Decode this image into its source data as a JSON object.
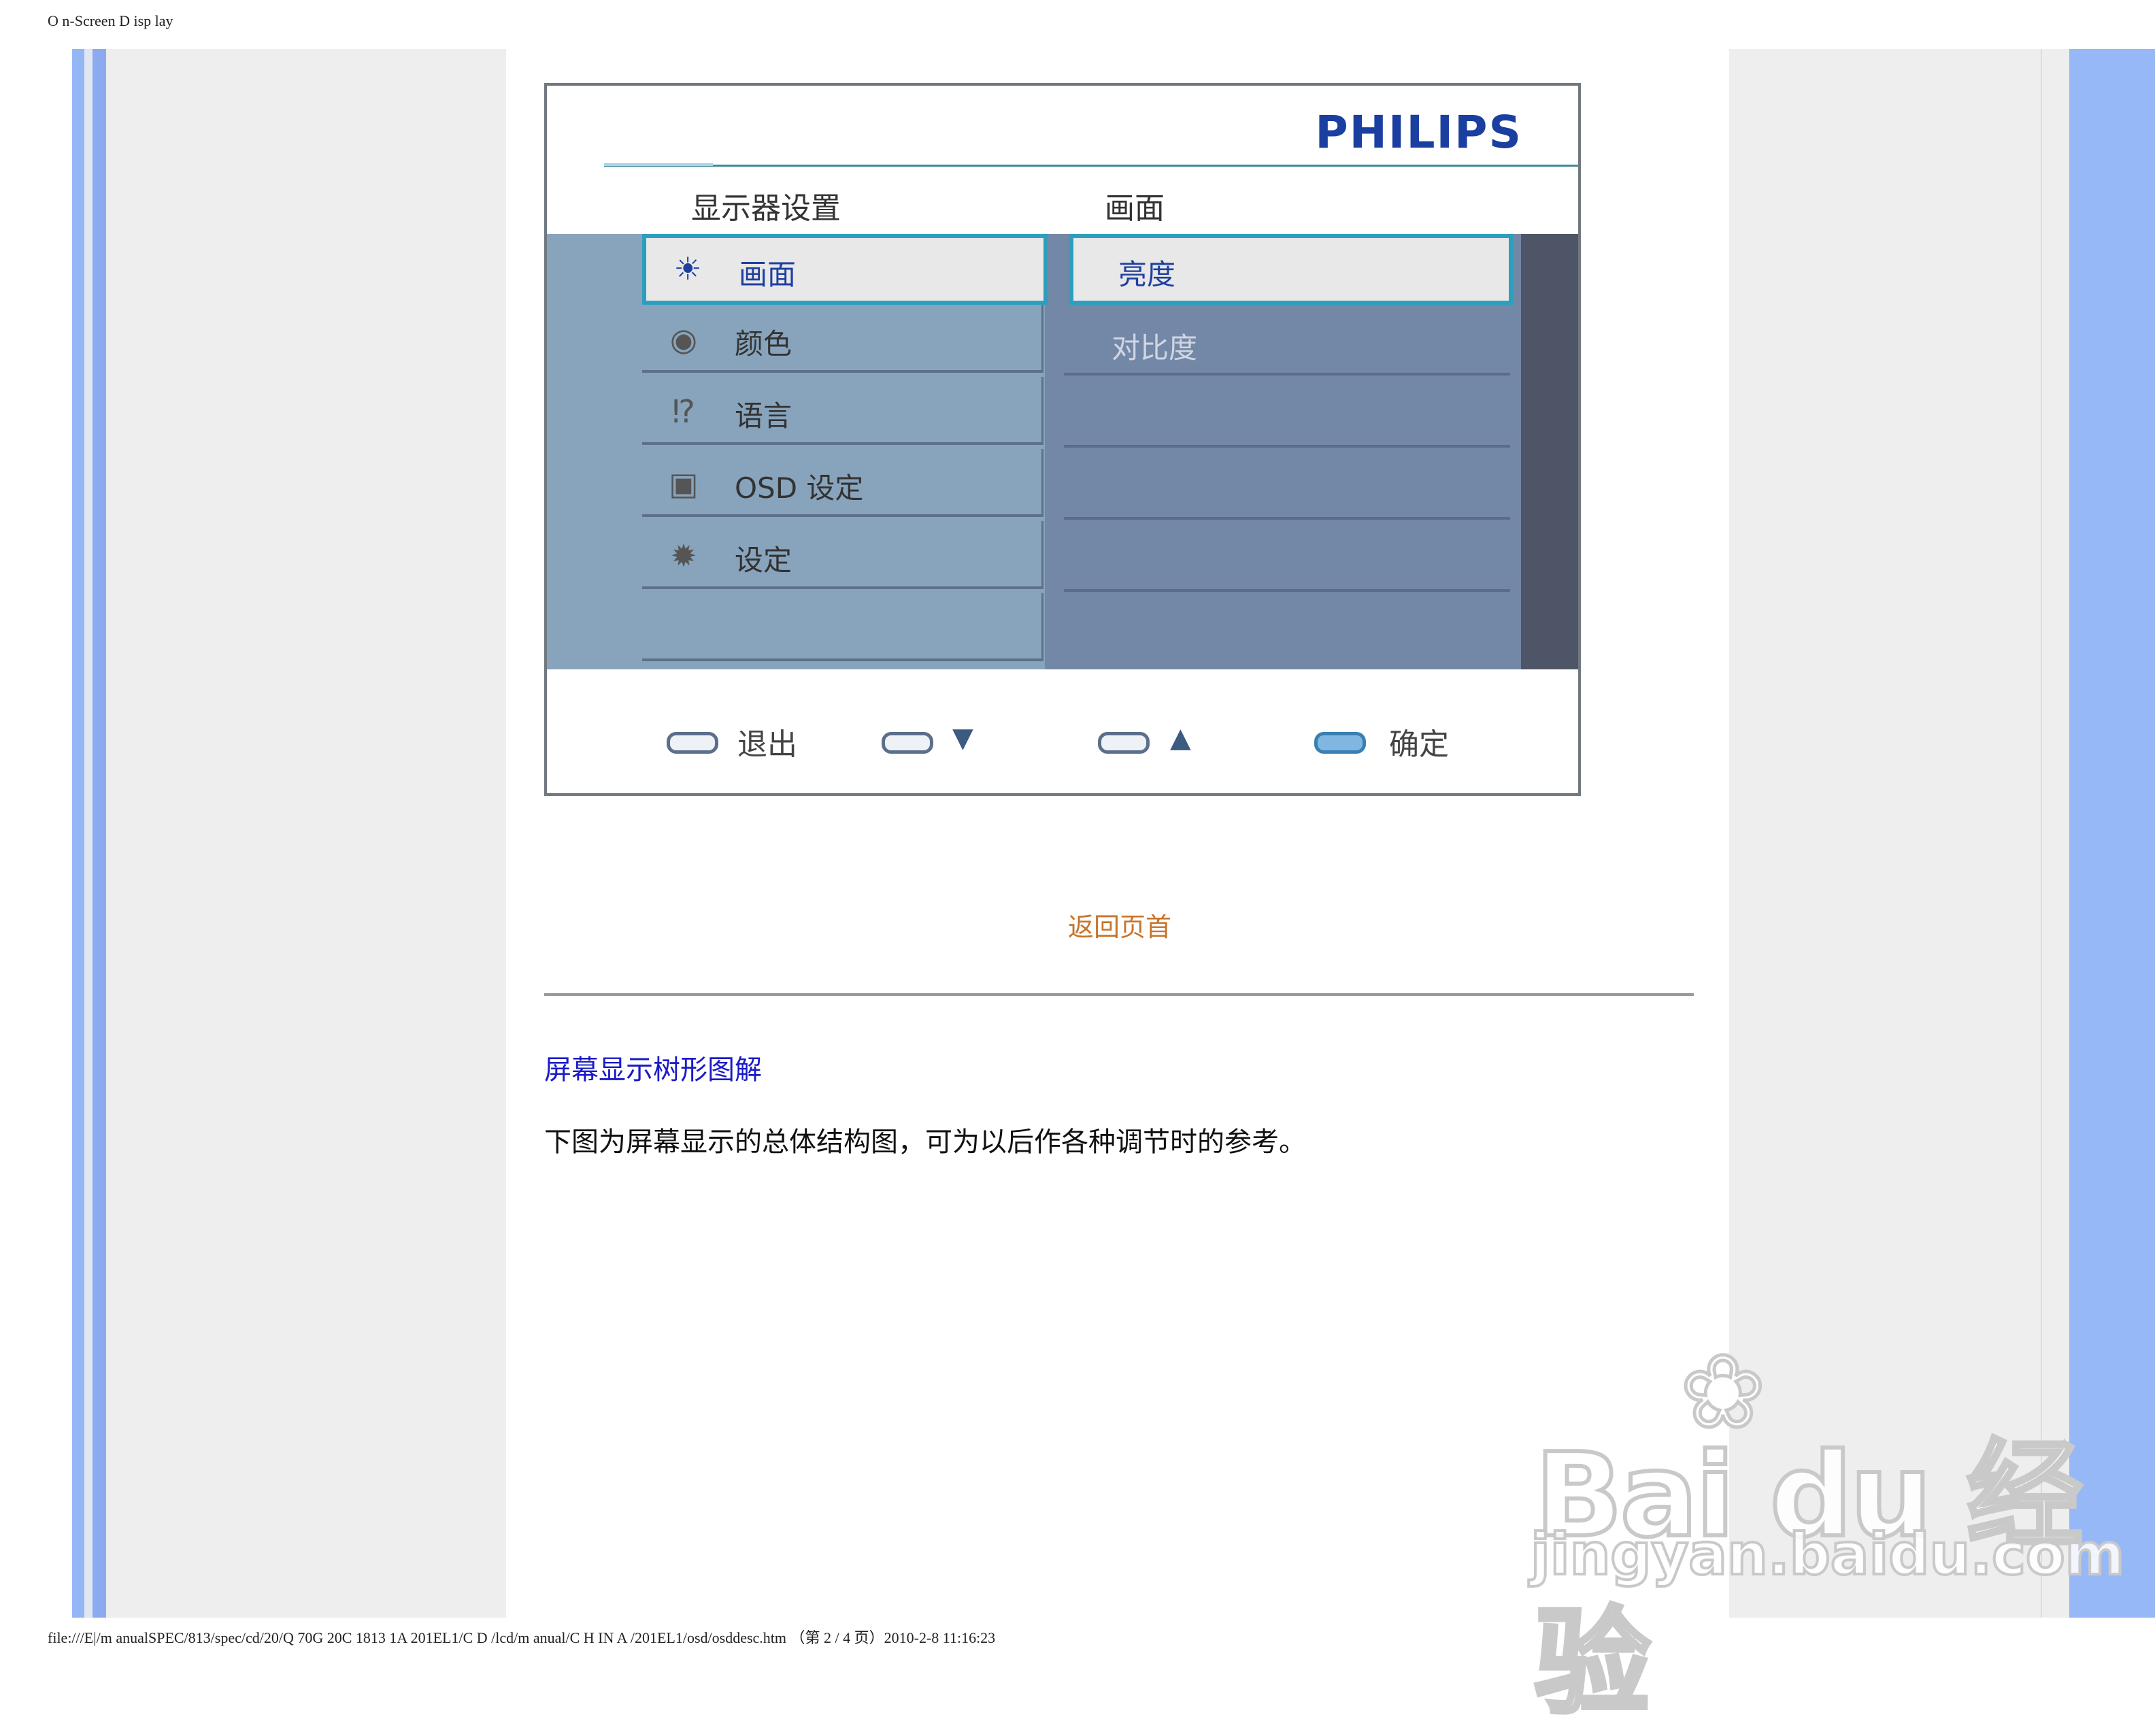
{
  "page_header": "O n-Screen D isp lay",
  "page_footer": "file:///E|/m anualSPEC/813/spec/cd/20/Q 70G 20C 1813 1A 201EL1/C D /lcd/m anual/C H IN A /201EL1/osd/osddesc.htm （第 2 / 4 页）2010-2-8 11:16:23",
  "osd": {
    "brand": "PHILIPS",
    "header_left": "显示器设置",
    "header_right": "画面",
    "menu_items": [
      {
        "icon": "brightness-icon",
        "glyph": "☀",
        "label": "画面"
      },
      {
        "icon": "color-icon",
        "glyph": "◉",
        "label": "颜色"
      },
      {
        "icon": "language-icon",
        "glyph": "⁉",
        "label": "语言"
      },
      {
        "icon": "osd-icon",
        "glyph": "▣",
        "label": "OSD 设定"
      },
      {
        "icon": "settings-icon",
        "glyph": "✹",
        "label": "设定"
      }
    ],
    "submenu_items": [
      "亮度",
      "对比度"
    ],
    "buttons": [
      {
        "label": "退出"
      },
      {
        "arrow": "▼"
      },
      {
        "arrow": "▲"
      },
      {
        "label": "确定"
      }
    ]
  },
  "back_to_top": "返回页首",
  "section_title": "屏幕显示树形图解",
  "paragraph": "下图为屏幕显示的总体结构图，可为以后作各种调节时的参考。",
  "watermark": {
    "logo_text": "Bai du 经验",
    "url": "jingyan.baidu.com"
  }
}
